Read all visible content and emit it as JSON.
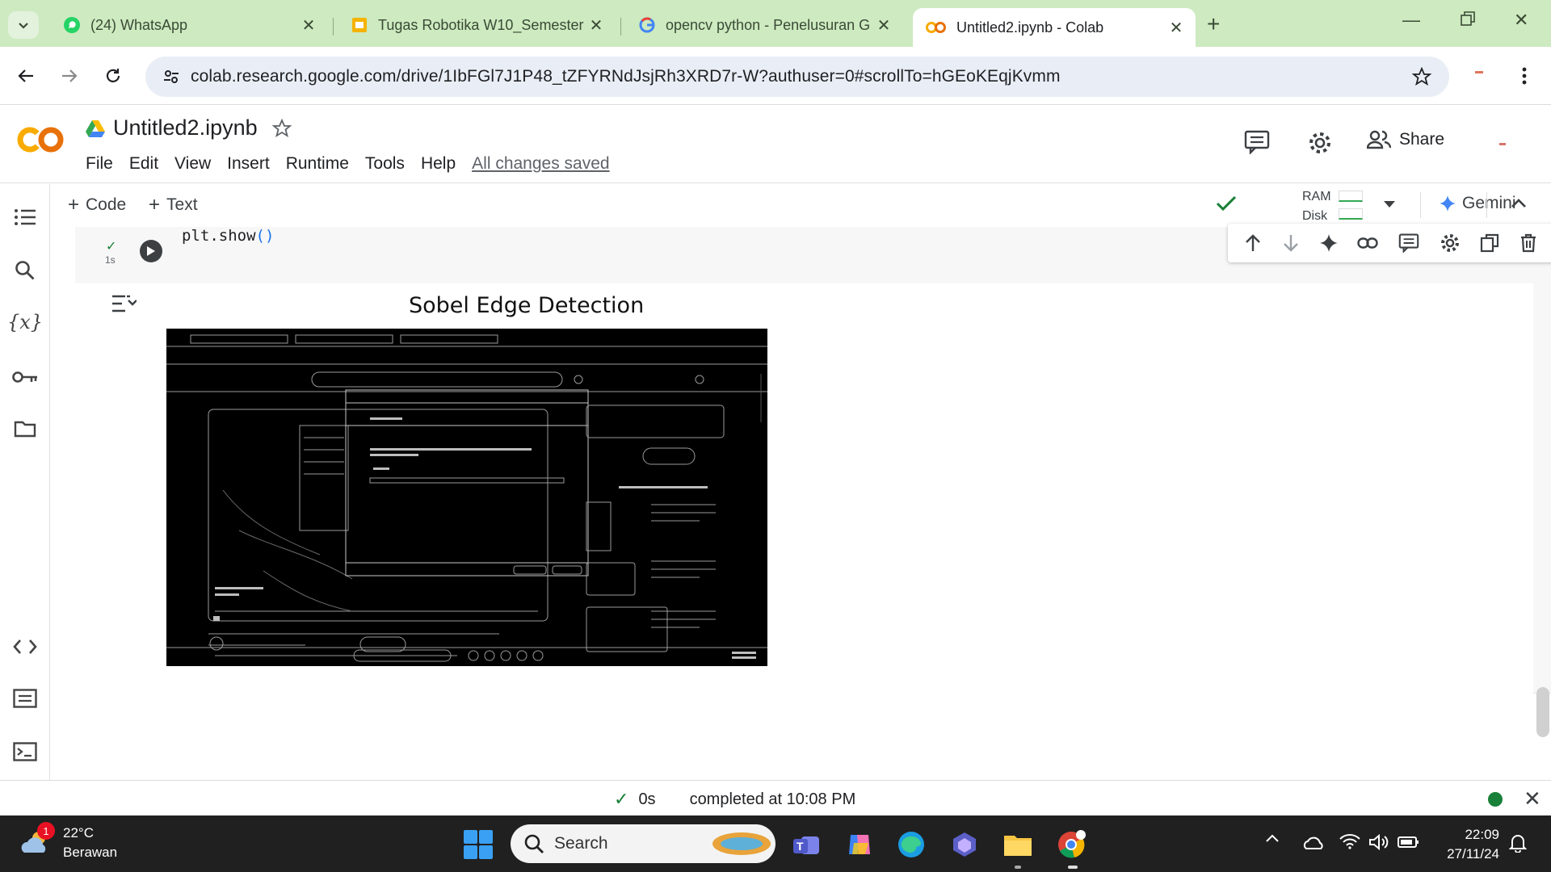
{
  "browser": {
    "tabs": [
      {
        "title": "(24) WhatsApp",
        "icon": "whatsapp-icon"
      },
      {
        "title": "Tugas Robotika W10_Semester",
        "icon": "slides-icon"
      },
      {
        "title": "opencv python - Penelusuran G",
        "icon": "google-icon"
      },
      {
        "title": "Untitled2.ipynb - Colab",
        "icon": "colab-icon",
        "active": true
      }
    ],
    "url": "colab.research.google.com/drive/1IbFGl7J1P48_tZFYRNdJsjRh3XRD7r-W?authuser=0#scrollTo=hGEoKEqjKvmm"
  },
  "colab": {
    "logo": "CO",
    "notebook_title": "Untitled2.ipynb",
    "menu": [
      "File",
      "Edit",
      "View",
      "Insert",
      "Runtime",
      "Tools",
      "Help"
    ],
    "save_status": "All changes saved",
    "share_label": "Share",
    "add_code_label": "Code",
    "add_text_label": "Text",
    "ram_label": "RAM",
    "disk_label": "Disk",
    "gemini_label": "Gemini"
  },
  "cell": {
    "code": "plt.show",
    "code_parens": "()",
    "exec_time": "1s",
    "plot_title": "Sobel Edge Detection"
  },
  "status": {
    "time": "0s",
    "message": "completed at 10:08 PM"
  },
  "taskbar": {
    "temperature": "22°C",
    "weather": "Berawan",
    "notification_count": "1",
    "search_placeholder": "Search",
    "time": "22:09",
    "date": "27/11/24"
  },
  "colors": {
    "tabstrip": "#cdeac0",
    "colab_orange": "#e8710a",
    "colab_yellow": "#f9ab00",
    "success_green": "#188038",
    "taskbar": "#202020"
  }
}
